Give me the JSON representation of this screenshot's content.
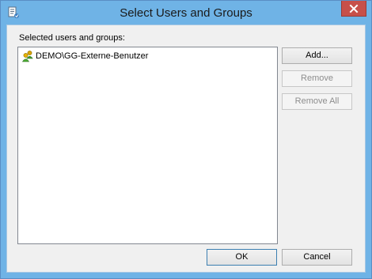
{
  "window": {
    "title": "Select Users and Groups",
    "close_icon": "close-icon"
  },
  "content": {
    "list_label": "Selected users and groups:",
    "items": [
      {
        "label": "DEMO\\GG-Externe-Benutzer",
        "icon": "user-group-icon"
      }
    ]
  },
  "buttons": {
    "add": "Add...",
    "remove": "Remove",
    "remove_all": "Remove All",
    "ok": "OK",
    "cancel": "Cancel"
  },
  "colors": {
    "titlebar": "#6fb3e6",
    "close_button": "#c7504a",
    "dialog_background": "#f0f0f0"
  }
}
